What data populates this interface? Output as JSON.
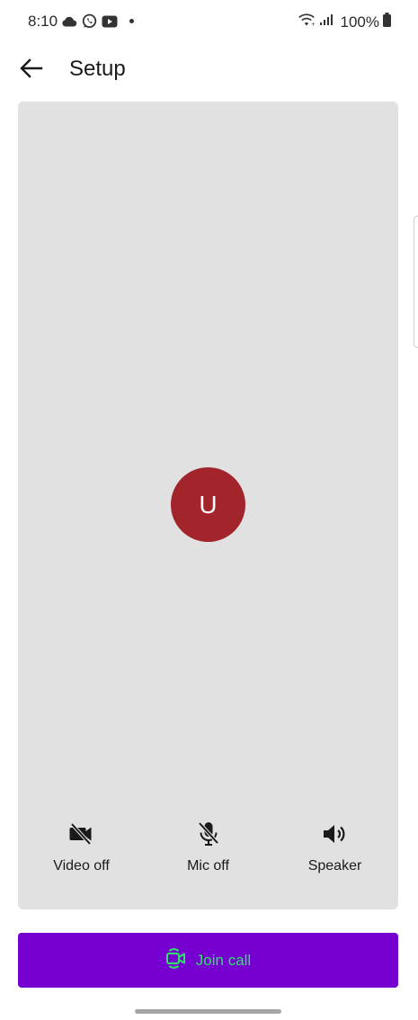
{
  "status_bar": {
    "time": "8:10",
    "battery": "100%",
    "icons": [
      "cloud-icon",
      "whatsapp-icon",
      "youtube-icon",
      "notification-dot",
      "wifi-icon",
      "signal-icon",
      "battery-icon"
    ]
  },
  "app_bar": {
    "back_icon": "arrow-left-icon",
    "title": "Setup"
  },
  "preview": {
    "background": "#e2e1e2",
    "avatar_initial": "U",
    "avatar_color": "#a2252b"
  },
  "controls": [
    {
      "label": "Video off",
      "icon": "video-off-icon"
    },
    {
      "label": "Mic off",
      "icon": "mic-off-icon"
    },
    {
      "label": "Speaker",
      "icon": "speaker-icon"
    }
  ],
  "join": {
    "label": "Join call",
    "icon": "video-call-icon",
    "background": "#7600cf",
    "text_color": "#2ee36a"
  }
}
